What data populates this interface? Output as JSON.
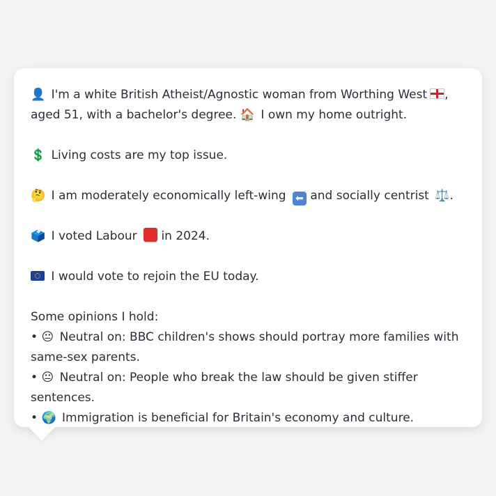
{
  "profile": {
    "line1_icon": "👤",
    "line1_text_a": "I'm a white British Atheist/Agnostic woman from Worthing West",
    "line1_flag": "england-flag-icon",
    "line1_text_b": ", aged 51, with a bachelor's degree.",
    "line1_home_icon": "🏠",
    "line1_text_c": "I own my home outright.",
    "line2_icon": "💲",
    "line2_text": "Living costs are my top issue.",
    "line3_icon": "🤔",
    "line3_text_a": "I am moderately economically left-wing",
    "line3_arrow": "⬅",
    "line3_text_b": "and socially centrist",
    "line3_scales": "⚖️",
    "line3_text_c": ".",
    "line4_icon": "🗳️",
    "line4_text_a": "I voted Labour",
    "line4_square": "red-square-icon",
    "line4_text_b": "in 2024.",
    "line5_icon": "eu-flag-icon",
    "line5_text": "I would vote to rejoin the EU today."
  },
  "opinions": {
    "heading": "Some opinions I hold:",
    "items": [
      {
        "bullet": "•",
        "icon": "😐",
        "text": "Neutral on: BBC children's shows should portray more families with same-sex parents."
      },
      {
        "bullet": "•",
        "icon": "😐",
        "text": "Neutral on: People who break the law should be given stiffer sentences."
      },
      {
        "bullet": "•",
        "icon": "🌍",
        "text": "Immigration is beneficial for Britain's economy and culture."
      }
    ]
  }
}
